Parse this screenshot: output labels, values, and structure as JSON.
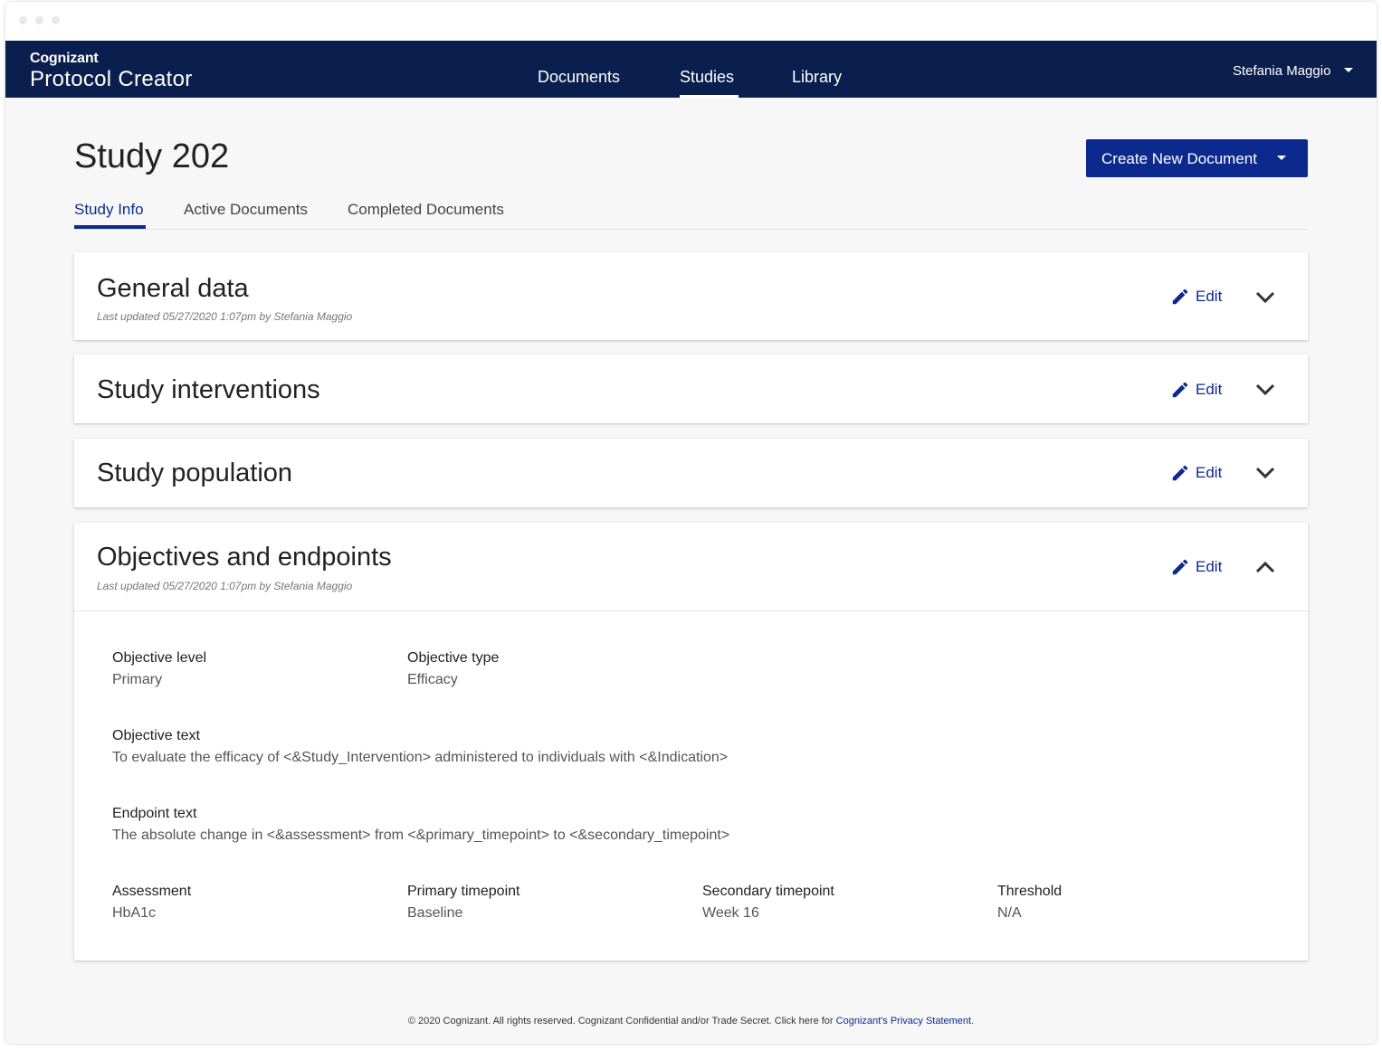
{
  "app": {
    "company": "Cognizant",
    "product": "Protocol Creator"
  },
  "nav": {
    "items": [
      {
        "label": "Documents"
      },
      {
        "label": "Studies",
        "active": true
      },
      {
        "label": "Library"
      }
    ],
    "user": "Stefania Maggio"
  },
  "page": {
    "title": "Study 202",
    "create_button": "Create New Document"
  },
  "tabs": [
    {
      "label": "Study Info",
      "active": true
    },
    {
      "label": "Active Documents"
    },
    {
      "label": "Completed Documents"
    }
  ],
  "sections": [
    {
      "title": "General data",
      "meta": "Last updated 05/27/2020 1:07pm by Stefania Maggio",
      "edit": "Edit",
      "expanded": false
    },
    {
      "title": "Study interventions",
      "edit": "Edit",
      "expanded": false
    },
    {
      "title": "Study population",
      "edit": "Edit",
      "expanded": false
    },
    {
      "title": "Objectives and endpoints",
      "meta": "Last updated 05/27/2020 1:07pm by Stefania Maggio",
      "edit": "Edit",
      "expanded": true
    }
  ],
  "objectives": {
    "objective_level": {
      "label": "Objective level",
      "value": "Primary"
    },
    "objective_type": {
      "label": "Objective type",
      "value": "Efficacy"
    },
    "objective_text": {
      "label": "Objective text",
      "value": "To evaluate the efficacy of <&Study_Intervention> administered to individuals with <&Indication>"
    },
    "endpoint_text": {
      "label": "Endpoint text",
      "value": "The absolute change in <&assessment> from <&primary_timepoint> to <&secondary_timepoint>"
    },
    "assessment": {
      "label": "Assessment",
      "value": "HbA1c"
    },
    "primary_timepoint": {
      "label": "Primary timepoint",
      "value": "Baseline"
    },
    "secondary_timepoint": {
      "label": "Secondary timepoint",
      "value": "Week 16"
    },
    "threshold": {
      "label": "Threshold",
      "value": "N/A"
    }
  },
  "footer": {
    "text": "© 2020 Cognizant. All rights reserved. Cognizant Confidential and/or Trade Secret. Click here for ",
    "link": "Cognizant's Privacy Statement",
    "end": "."
  },
  "colors": {
    "navbar": "#0a1f4e",
    "accent": "#0c2a8e",
    "background": "#f7f7f7"
  },
  "icons": [
    "pencil-icon",
    "chevron-down-icon",
    "chevron-up-icon",
    "caret-down-icon"
  ]
}
